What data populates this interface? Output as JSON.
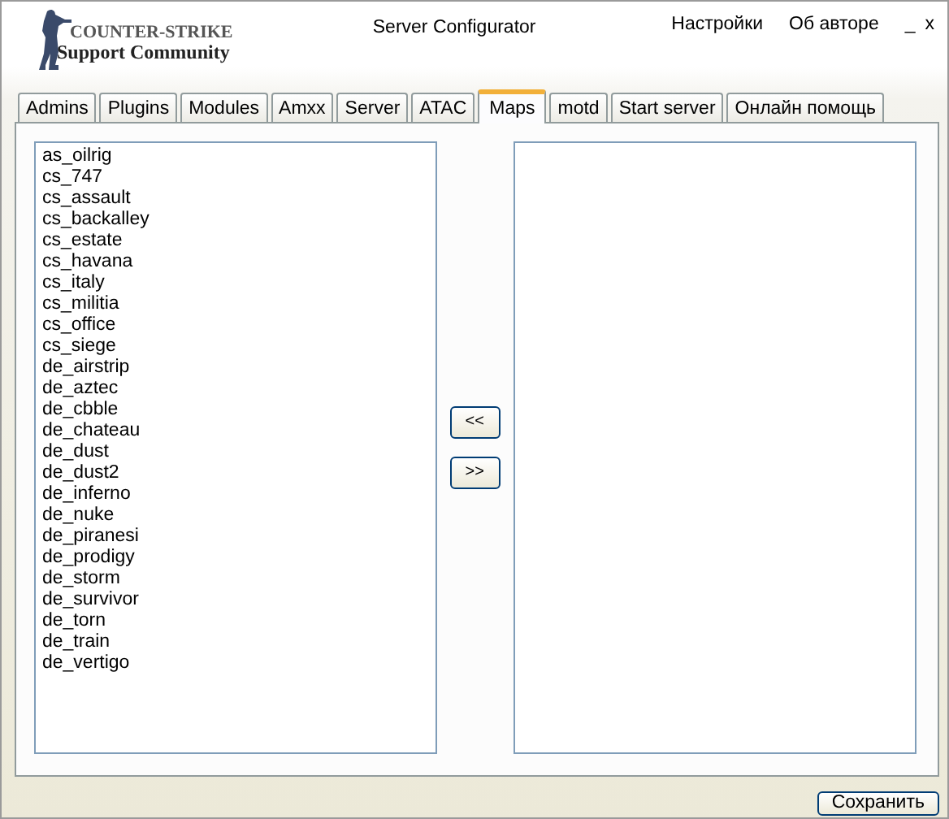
{
  "logo": {
    "line_1": "COUNTER-STRIKE",
    "line_2": "Support Community"
  },
  "window": {
    "title": "Server Configurator"
  },
  "menu": [
    "Настройки",
    "Об авторе"
  ],
  "window_controls": [
    "_",
    "x"
  ],
  "tabs": [
    {
      "label": "Admins",
      "selected": false
    },
    {
      "label": "Plugins",
      "selected": false
    },
    {
      "label": "Modules",
      "selected": false
    },
    {
      "label": "Amxx",
      "selected": false
    },
    {
      "label": "Server",
      "selected": false
    },
    {
      "label": "ATAC",
      "selected": false
    },
    {
      "label": "Maps",
      "selected": true
    },
    {
      "label": "motd",
      "selected": false
    },
    {
      "label": "Start server",
      "selected": false
    },
    {
      "label": "Онлайн помощь",
      "selected": false
    }
  ],
  "available_maps": [
    "as_oilrig",
    "cs_747",
    "cs_assault",
    "cs_backalley",
    "cs_estate",
    "cs_havana",
    "cs_italy",
    "cs_militia",
    "cs_office",
    "cs_siege",
    "de_airstrip",
    "de_aztec",
    "de_cbble",
    "de_chateau",
    "de_dust",
    "de_dust2",
    "de_inferno",
    "de_nuke",
    "de_piranesi",
    "de_prodigy",
    "de_storm",
    "de_survivor",
    "de_torn",
    "de_train",
    "de_vertigo"
  ],
  "move_buttons": [
    "<<",
    ">>"
  ],
  "save_button": "Сохранить"
}
